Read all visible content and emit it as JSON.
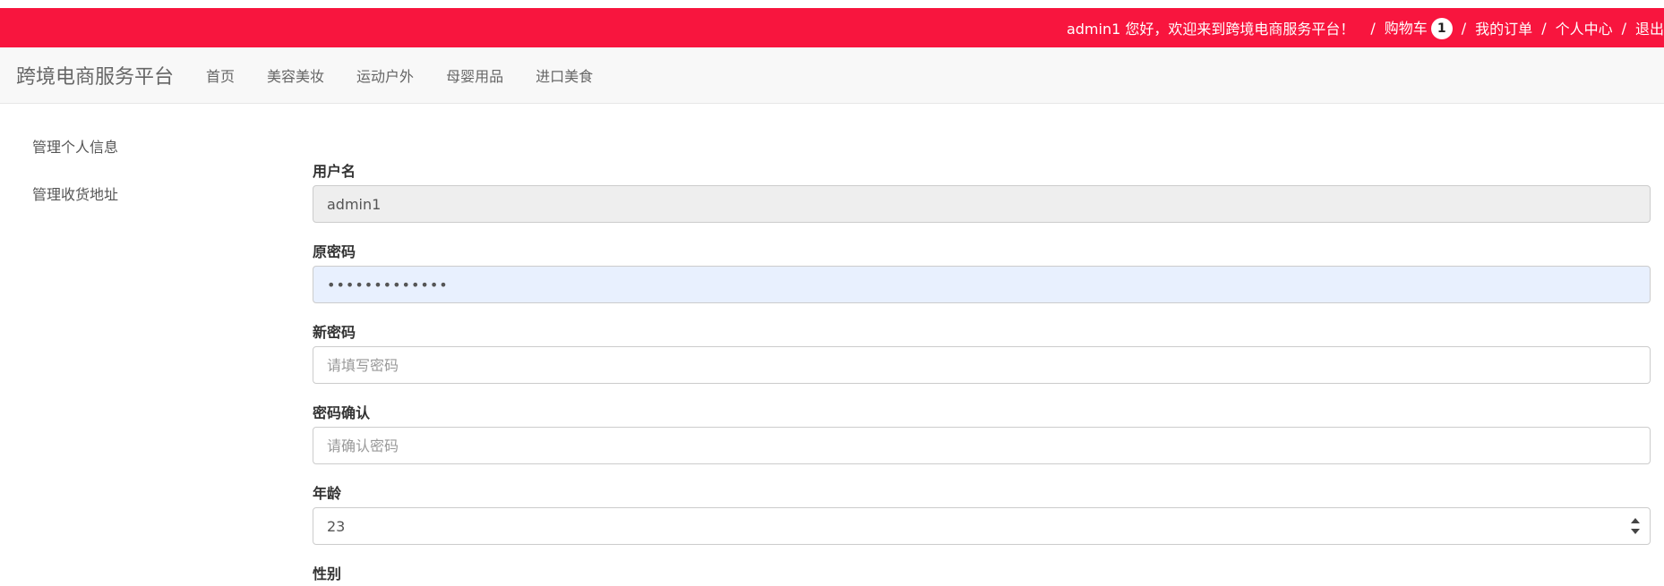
{
  "top_bar": {
    "greeting": "admin1 您好，欢迎来到跨境电商服务平台！",
    "cart_label": "购物车",
    "cart_count": "1",
    "orders_label": "我的订单",
    "profile_label": "个人中心",
    "logout_label": "退出",
    "separator": "/",
    "color": "#f8153e"
  },
  "navbar": {
    "brand": "跨境电商服务平台",
    "items": [
      "首页",
      "美容美妆",
      "运动户外",
      "母婴用品",
      "进口美食"
    ]
  },
  "sidebar": {
    "items": [
      "管理个人信息",
      "管理收货地址"
    ]
  },
  "form": {
    "username": {
      "label": "用户名",
      "value": "admin1"
    },
    "old_password": {
      "label": "原密码",
      "value": "•••••••••••••"
    },
    "new_password": {
      "label": "新密码",
      "placeholder": "请填写密码"
    },
    "confirm_password": {
      "label": "密码确认",
      "placeholder": "请确认密码"
    },
    "age": {
      "label": "年龄",
      "value": "23"
    },
    "gender": {
      "label": "性别"
    }
  }
}
